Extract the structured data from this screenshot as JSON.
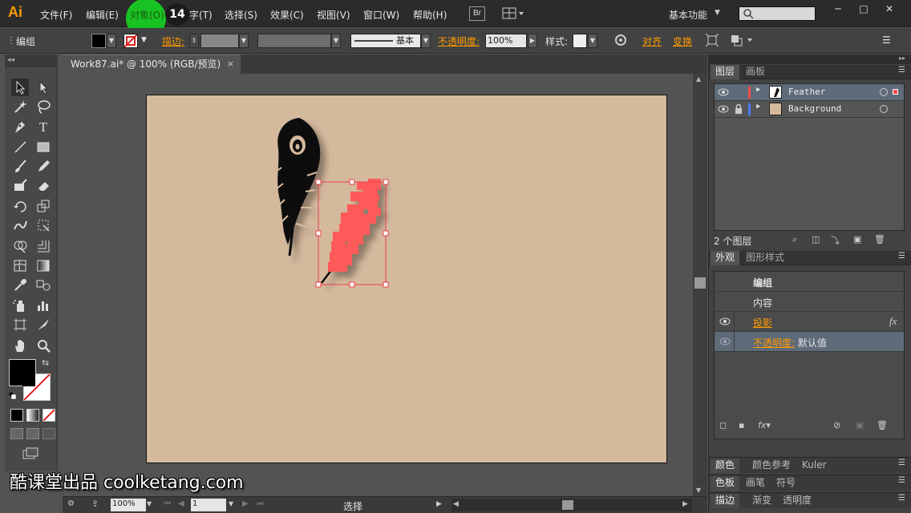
{
  "app": {
    "logo": "Ai"
  },
  "menu": {
    "items": [
      {
        "label": "文件(F)"
      },
      {
        "label": "编辑(E)"
      },
      {
        "label": "对象(O)"
      },
      {
        "label": "字(T)"
      },
      {
        "label": "选择(S)"
      },
      {
        "label": "效果(C)"
      },
      {
        "label": "视图(V)"
      },
      {
        "label": "窗口(W)"
      },
      {
        "label": "帮助(H)"
      }
    ],
    "step_badge": "14",
    "br_label": "Br",
    "workspace": "基本功能",
    "highlight_color": "#19c223"
  },
  "control_bar": {
    "selection_label": "编组",
    "stroke_label": "描边:",
    "stroke_style_label": "基本",
    "opacity_label": "不透明度:",
    "opacity_value": "100%",
    "style_label": "样式:",
    "align_label": "对齐",
    "transform_label": "变换"
  },
  "document": {
    "tab_title": "Work87.ai* @ 100% (RGB/预览)",
    "close_glyph": "×",
    "artboard_color": "#d5b99d",
    "feather_black_color": "#111111",
    "feather_red_color": "#ff5a5a",
    "selection_color": "#e8404a"
  },
  "status_bar": {
    "zoom": "100%",
    "page": "1",
    "tool": "选择"
  },
  "layers_panel": {
    "tabs": [
      "图层",
      "画板"
    ],
    "layers": [
      {
        "name": "Feather",
        "color": "#ff4b4b"
      },
      {
        "name": "Background",
        "color": "#4b7bff"
      }
    ],
    "count_label": "2 个图层"
  },
  "appearance_panel": {
    "tabs": [
      "外观",
      "图形样式"
    ],
    "rows": [
      {
        "label": "编组"
      },
      {
        "label": "内容"
      },
      {
        "label": "投影"
      },
      {
        "prefix": "不透明度:",
        "value": "默认值"
      }
    ],
    "fx_glyph": "fx"
  },
  "collapsed_panels": [
    {
      "tabs": [
        "颜色",
        "颜色参考",
        "Kuler"
      ]
    },
    {
      "tabs": [
        "色板",
        "画笔",
        "符号"
      ]
    },
    {
      "tabs": [
        "描边",
        "渐变",
        "透明度"
      ]
    }
  ],
  "watermark": "酷课堂出品 coolketang.com",
  "accent_color": "#ff9a00"
}
